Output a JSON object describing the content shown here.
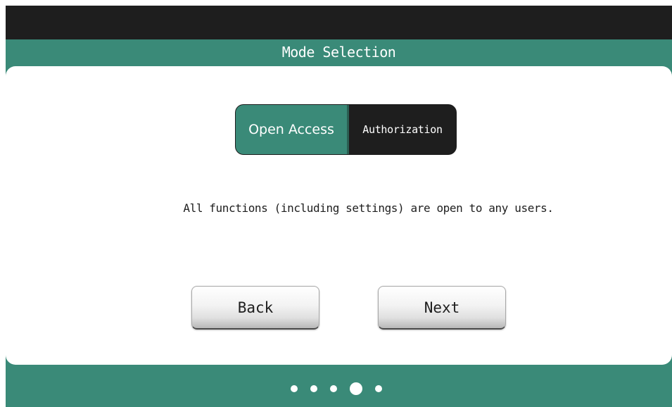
{
  "header": {
    "title": "Mode Selection"
  },
  "mode_toggle": {
    "options": [
      {
        "label": "Open Access",
        "selected": true
      },
      {
        "label": "Authorization",
        "selected": false
      }
    ]
  },
  "description": "All functions (including settings) are open to any users.",
  "buttons": {
    "back_label": "Back",
    "next_label": "Next"
  },
  "pager": {
    "total_pages": 5,
    "current_page": 4
  },
  "colors": {
    "accent_green": "#3a8a78",
    "dark": "#1e1e1e",
    "panel": "#ffffff"
  }
}
